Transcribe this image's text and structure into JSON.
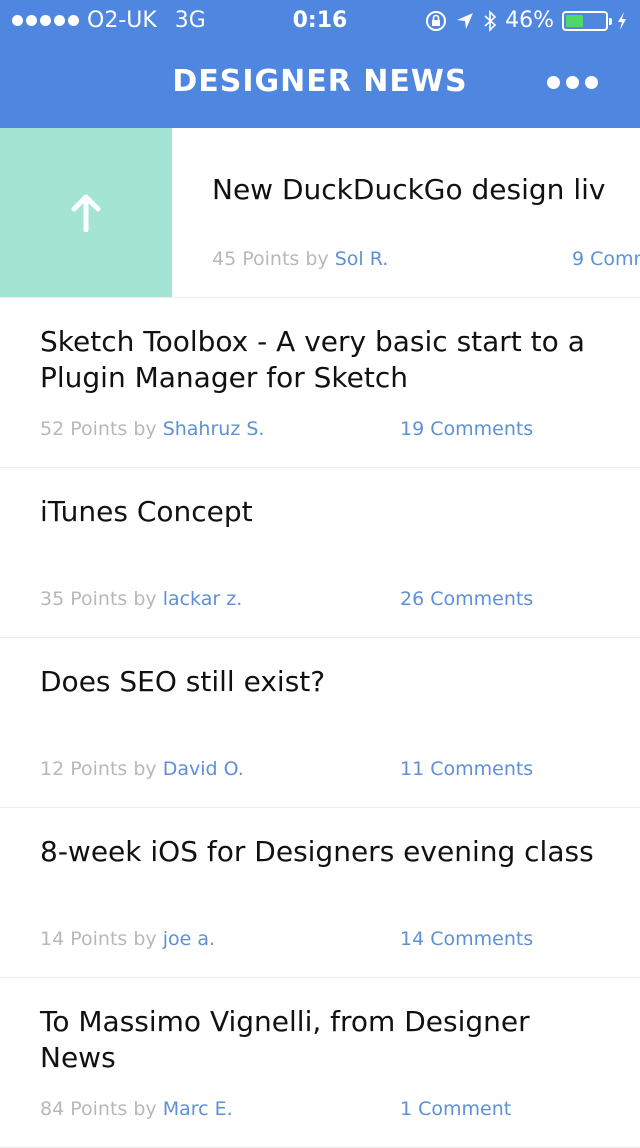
{
  "status_bar": {
    "carrier": "O2-UK",
    "network": "3G",
    "time": "0:16",
    "battery_percent": "46%",
    "battery_level": 0.46,
    "icons": [
      "rotation-lock-icon",
      "location-arrow-icon",
      "bluetooth-icon",
      "battery-icon",
      "charging-bolt-icon"
    ]
  },
  "header": {
    "title": "DESIGNER NEWS",
    "more_icon": "more-dots-icon"
  },
  "colors": {
    "header_bg": "#4f86e0",
    "upvote_bg": "#a3e4d3",
    "link": "#5e90d8",
    "muted": "#b8b8b8"
  },
  "stories": [
    {
      "title": "New DuckDuckGo design liv",
      "points": "45 Points by",
      "author": "Sol R.",
      "comments": "9 Comm"
    },
    {
      "title": "Sketch Toolbox - A very basic start to a Plugin Manager for Sketch",
      "points": "52 Points by",
      "author": "Shahruz S.",
      "comments": "19 Comments"
    },
    {
      "title": "iTunes Concept",
      "points": "35 Points by",
      "author": "lackar z.",
      "comments": "26 Comments"
    },
    {
      "title": "Does SEO still exist?",
      "points": "12 Points by",
      "author": "David O.",
      "comments": "11 Comments"
    },
    {
      "title": "8-week iOS for Designers evening class",
      "points": "14 Points by",
      "author": "joe a.",
      "comments": "14 Comments"
    },
    {
      "title": "To Massimo Vignelli, from Designer News",
      "points": "84 Points by",
      "author": "Marc E.",
      "comments": "1 Comment"
    }
  ]
}
